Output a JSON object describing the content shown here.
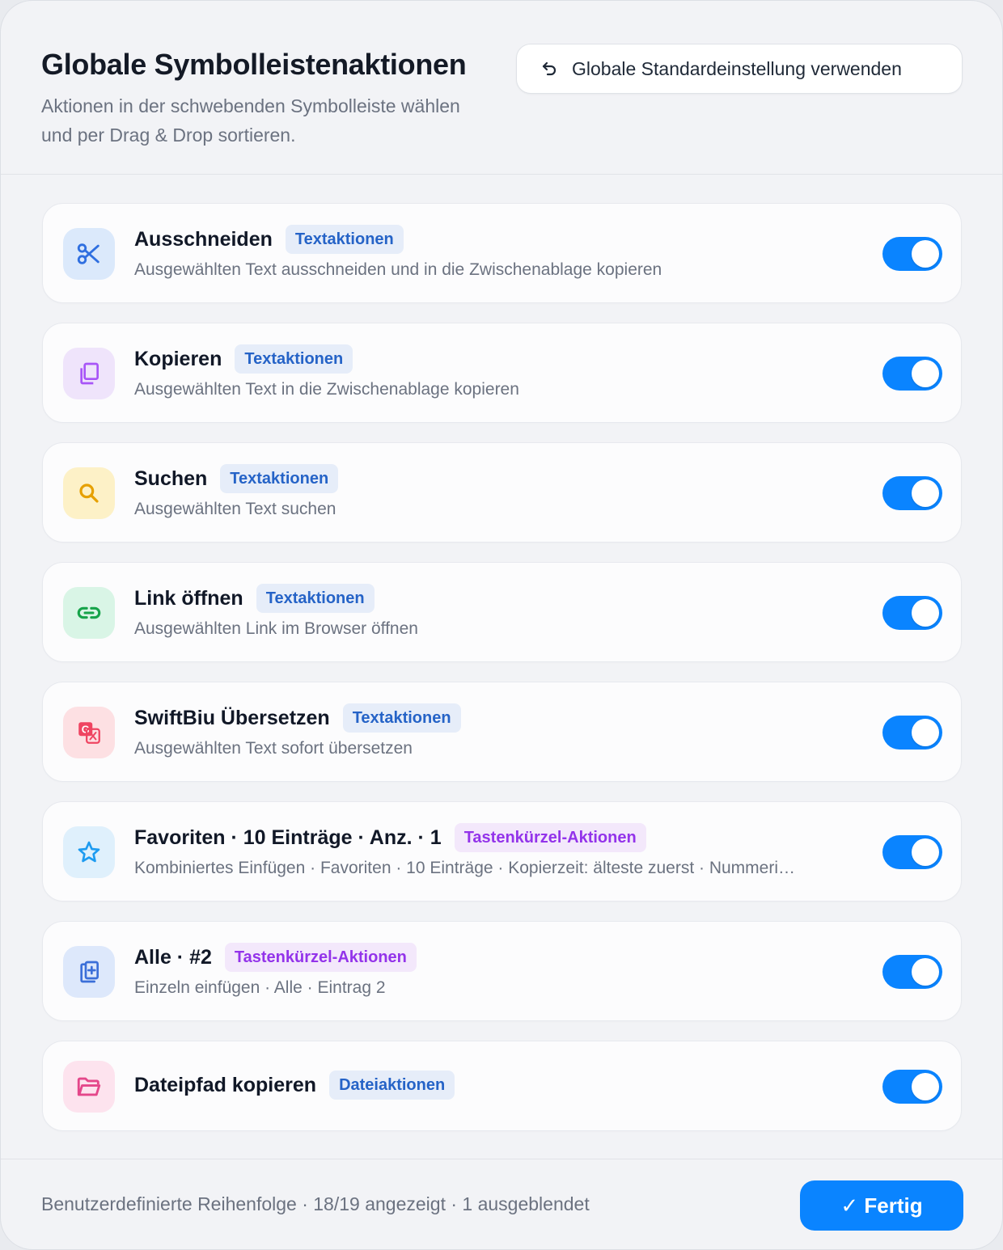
{
  "header": {
    "title": "Globale Symbolleistenaktionen",
    "subtitle": "Aktionen in der schwebenden Symbolleiste wählen und per Drag & Drop sortieren.",
    "reset_label": "Globale Standardeinstellung verwenden",
    "reset_icon": "undo-arrow-icon"
  },
  "actions": [
    {
      "title": "Ausschneiden",
      "badge": "Textaktionen",
      "badge_type": "text",
      "description": "Ausgewählten Text ausschneiden und in die Zwischenablage kopieren",
      "icon": "scissors-icon",
      "enabled": true
    },
    {
      "title": "Kopieren",
      "badge": "Textaktionen",
      "badge_type": "text",
      "description": "Ausgewählten Text in die Zwischenablage kopieren",
      "icon": "copy-icon",
      "enabled": true
    },
    {
      "title": "Suchen",
      "badge": "Textaktionen",
      "badge_type": "text",
      "description": "Ausgewählten Text suchen",
      "icon": "search-icon",
      "enabled": true
    },
    {
      "title": "Link öffnen",
      "badge": "Textaktionen",
      "badge_type": "text",
      "description": "Ausgewählten Link im Browser öffnen",
      "icon": "link-icon",
      "enabled": true
    },
    {
      "title": "SwiftBiu Übersetzen",
      "badge": "Textaktionen",
      "badge_type": "text",
      "description": "Ausgewählten Text sofort übersetzen",
      "icon": "translate-icon",
      "enabled": true
    },
    {
      "title": "Favoriten · 10 Einträge · Anz. · 1",
      "badge": "Tastenkürzel-Aktionen",
      "badge_type": "shortcut",
      "description": "Kombiniertes Einfügen · Favoriten · 10 Einträge · Kopierzeit: älteste zuerst · Nummeri…",
      "icon": "star-icon",
      "enabled": true
    },
    {
      "title": "Alle · #2",
      "badge": "Tastenkürzel-Aktionen",
      "badge_type": "shortcut",
      "description": "Einzeln einfügen · Alle · Eintrag 2",
      "icon": "paste-add-icon",
      "enabled": true
    },
    {
      "title": "Dateipfad kopieren",
      "badge": "Dateiaktionen",
      "badge_type": "text",
      "description": "",
      "icon": "folder-icon",
      "enabled": true
    }
  ],
  "footer": {
    "status": "Benutzerdefinierte Reihenfolge · 18/19 angezeigt · 1 ausgeblendet",
    "done_label": "✓ Fertig"
  },
  "colors": {
    "accent": "#0a84ff",
    "badge_text_bg": "#e6edf9",
    "badge_text_fg": "#2563c7",
    "badge_shortcut_bg": "#f3e8fb",
    "badge_shortcut_fg": "#9333ea"
  }
}
